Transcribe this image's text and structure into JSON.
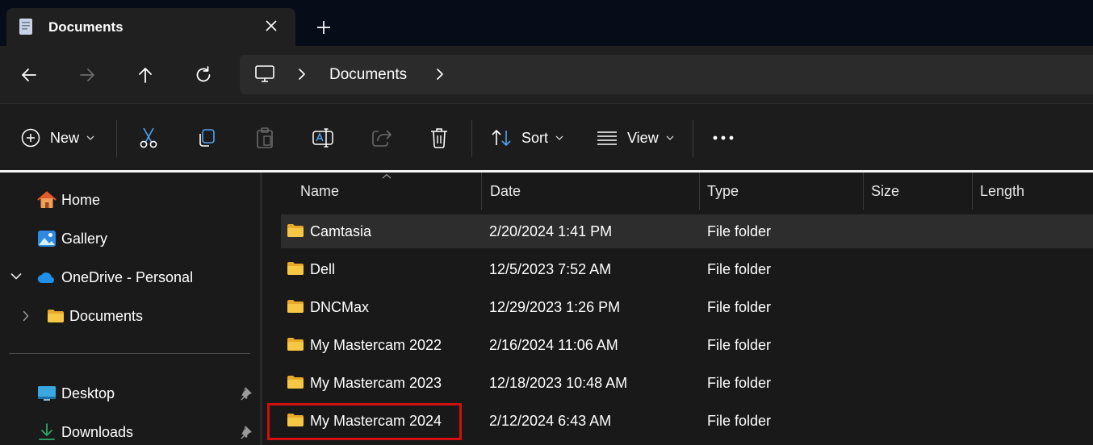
{
  "window": {
    "tab_title": "Documents"
  },
  "address": {
    "crumb": "Documents"
  },
  "toolbar": {
    "new_label": "New",
    "sort_label": "Sort",
    "view_label": "View"
  },
  "sidebar": {
    "items": [
      {
        "label": "Home",
        "icon": "home-icon"
      },
      {
        "label": "Gallery",
        "icon": "gallery-icon"
      },
      {
        "label": "OneDrive - Personal",
        "icon": "onedrive-icon",
        "expanded": true
      },
      {
        "label": "Documents",
        "icon": "folder-icon",
        "expanded": false
      },
      {
        "label": "Desktop",
        "icon": "desktop-icon",
        "pinned": true
      },
      {
        "label": "Downloads",
        "icon": "downloads-icon",
        "pinned": true
      }
    ]
  },
  "columns": [
    "Name",
    "Date",
    "Type",
    "Size",
    "Length"
  ],
  "files": [
    {
      "name": "Camtasia",
      "date": "2/20/2024 1:41 PM",
      "type": "File folder",
      "selected": true
    },
    {
      "name": "Dell",
      "date": "12/5/2023 7:52 AM",
      "type": "File folder"
    },
    {
      "name": "DNCMax",
      "date": "12/29/2023 1:26 PM",
      "type": "File folder"
    },
    {
      "name": "My Mastercam 2022",
      "date": "2/16/2024 11:06 AM",
      "type": "File folder"
    },
    {
      "name": "My Mastercam 2023",
      "date": "12/18/2023 10:48 AM",
      "type": "File folder"
    },
    {
      "name": "My Mastercam 2024",
      "date": "2/12/2024 6:43 AM",
      "type": "File folder",
      "highlighted": true
    }
  ],
  "colors": {
    "accent_highlight": "#d10f0f",
    "folder_yellow": "#f6c744",
    "onedrive_blue": "#1f8fe8"
  }
}
